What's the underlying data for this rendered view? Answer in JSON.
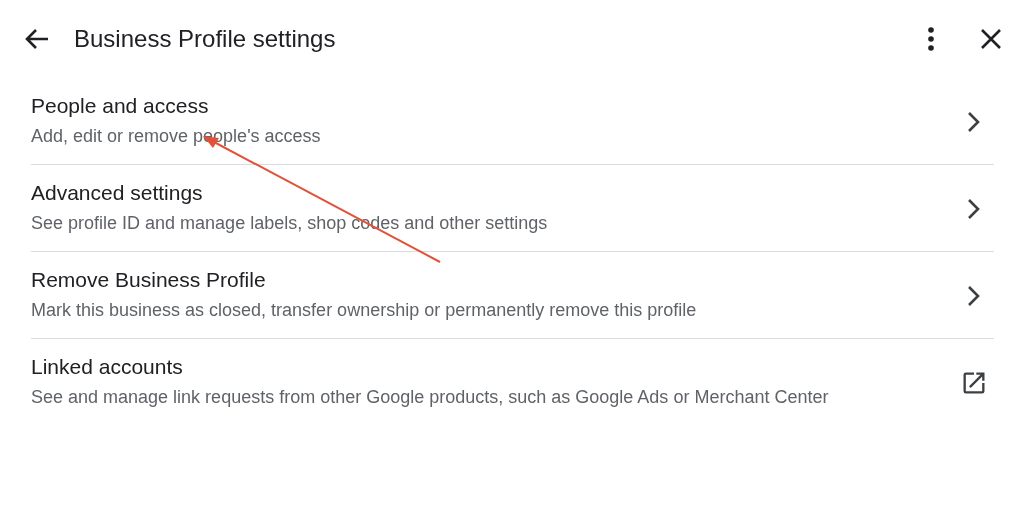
{
  "header": {
    "title": "Business Profile settings"
  },
  "items": [
    {
      "title": "People and access",
      "subtitle": "Add, edit or remove people's access",
      "kind": "chevron"
    },
    {
      "title": "Advanced settings",
      "subtitle": "See profile ID and manage labels, shop codes and other settings",
      "kind": "chevron"
    },
    {
      "title": "Remove Business Profile",
      "subtitle": "Mark this business as closed, transfer ownership or permanently remove this profile",
      "kind": "chevron"
    },
    {
      "title": "Linked accounts",
      "subtitle": "See and manage link requests from other Google products, such as Google Ads or Merchant Center",
      "kind": "external"
    }
  ]
}
